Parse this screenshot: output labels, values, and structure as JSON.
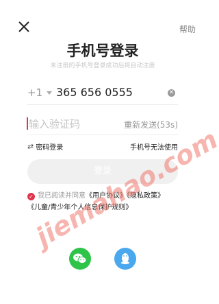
{
  "header": {
    "help_label": "帮助"
  },
  "title": "手机号登录",
  "subtitle": "未注册的手机号登录成功后将自动注册",
  "phone": {
    "country_code": "+1",
    "number": "365 656 0555"
  },
  "code": {
    "placeholder": "输入验证码",
    "resend_label": "重新发送(53s)"
  },
  "options": {
    "password_login": "密码登录",
    "cant_use_phone": "手机号无法使用"
  },
  "login_label": "登录",
  "agreement": {
    "prefix": "我已阅读并同意",
    "user_agreement": "《用户协议》",
    "privacy": "《隐私政策》",
    "children": "《儿童/青少年个人信息保护规则》"
  },
  "watermark": "jiemahao.com",
  "colors": {
    "accent": "#e0344a",
    "wechat": "#2ec44a",
    "qq": "#4aa8ee"
  }
}
